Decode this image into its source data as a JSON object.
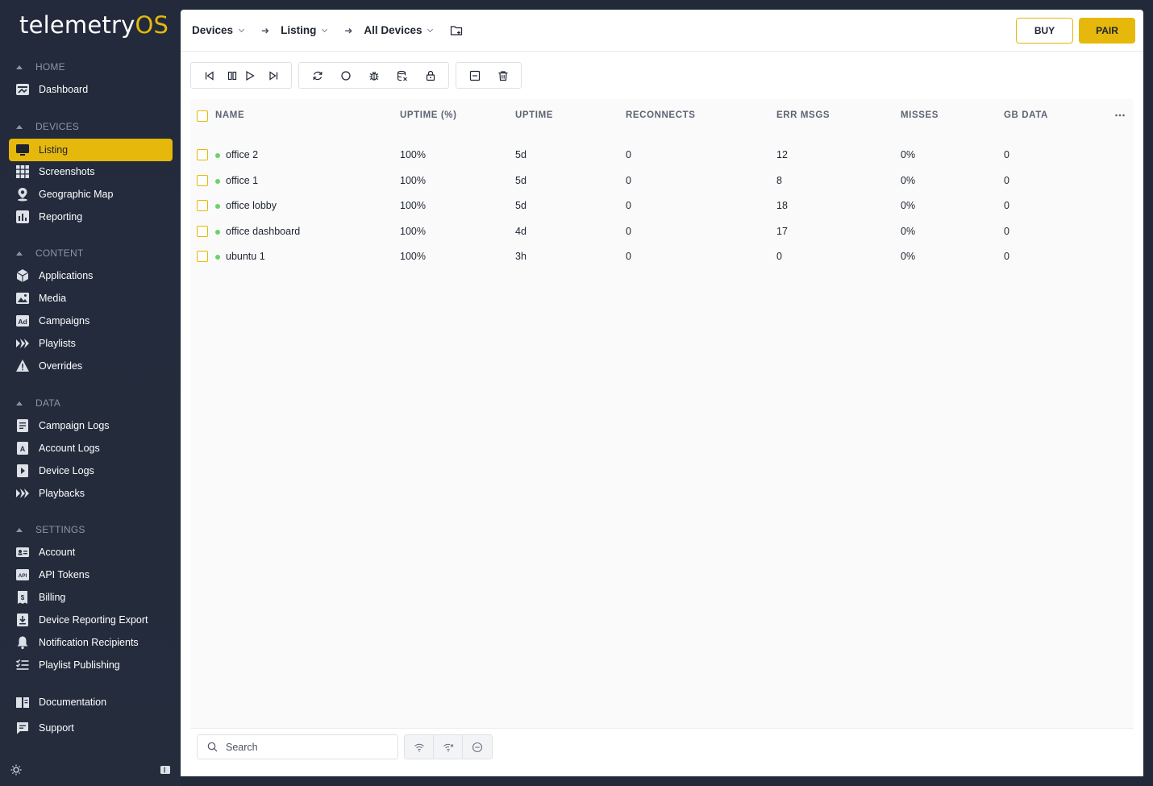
{
  "app": {
    "logo_main": "telemetry",
    "logo_accent": "OS"
  },
  "colors": {
    "accent": "#e5b80b",
    "sidebar_bg": "#222a3b",
    "online_dot": "#6ad26a"
  },
  "sidebar": {
    "sections": {
      "home": "HOME",
      "devices": "DEVICES",
      "content": "CONTENT",
      "data": "DATA",
      "settings": "SETTINGS"
    },
    "items": {
      "dashboard": "Dashboard",
      "listing": "Listing",
      "screenshots": "Screenshots",
      "geographic_map": "Geographic Map",
      "reporting": "Reporting",
      "applications": "Applications",
      "media": "Media",
      "campaigns": "Campaigns",
      "playlists": "Playlists",
      "overrides": "Overrides",
      "campaign_logs": "Campaign Logs",
      "account_logs": "Account Logs",
      "device_logs": "Device Logs",
      "playbacks": "Playbacks",
      "account": "Account",
      "api_tokens": "API Tokens",
      "billing": "Billing",
      "device_reporting_export": "Device Reporting Export",
      "notification_recipients": "Notification Recipients",
      "playlist_publishing": "Playlist Publishing",
      "documentation": "Documentation",
      "support": "Support"
    },
    "active_item": "Listing"
  },
  "header": {
    "breadcrumbs": [
      "Devices",
      "Listing",
      "All Devices"
    ],
    "buy_label": "BUY",
    "pair_label": "PAIR"
  },
  "table": {
    "columns": [
      "NAME",
      "UPTIME (%)",
      "UPTIME",
      "RECONNECTS",
      "ERR MSGS",
      "MISSES",
      "GB DATA"
    ],
    "rows": [
      {
        "name": "office 2",
        "uptime_pct": "100%",
        "uptime": "5d",
        "reconnects": "0",
        "err_msgs": "12",
        "misses": "0%",
        "gb_data": "0",
        "status": "online"
      },
      {
        "name": "office 1",
        "uptime_pct": "100%",
        "uptime": "5d",
        "reconnects": "0",
        "err_msgs": "8",
        "misses": "0%",
        "gb_data": "0",
        "status": "online"
      },
      {
        "name": "office lobby",
        "uptime_pct": "100%",
        "uptime": "5d",
        "reconnects": "0",
        "err_msgs": "18",
        "misses": "0%",
        "gb_data": "0",
        "status": "online"
      },
      {
        "name": "office dashboard",
        "uptime_pct": "100%",
        "uptime": "4d",
        "reconnects": "0",
        "err_msgs": "17",
        "misses": "0%",
        "gb_data": "0",
        "status": "online"
      },
      {
        "name": "ubuntu 1",
        "uptime_pct": "100%",
        "uptime": "3h",
        "reconnects": "0",
        "err_msgs": "0",
        "misses": "0%",
        "gb_data": "0",
        "status": "online"
      }
    ]
  },
  "footer": {
    "search_placeholder": "Search"
  }
}
